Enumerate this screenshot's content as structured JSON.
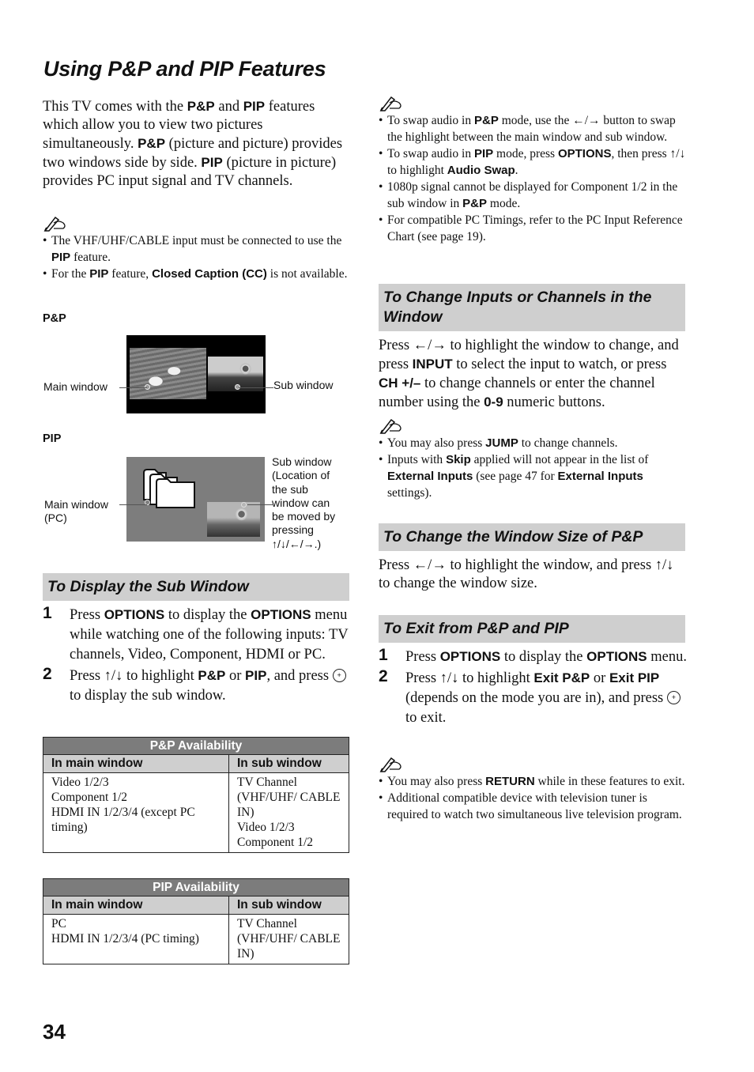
{
  "page": {
    "title": "Using P&P and PIP Features",
    "page_number": "34"
  },
  "intro": {
    "segments": [
      {
        "t": "This TV comes with the "
      },
      {
        "b": "P&P"
      },
      {
        "t": " and "
      },
      {
        "b": "PIP"
      },
      {
        "t": " features which allow you to view two pictures simultaneously. "
      },
      {
        "b": "P&P"
      },
      {
        "t": " (picture and picture) provides two windows side by side. "
      },
      {
        "b": "PIP"
      },
      {
        "t": " (picture in picture) provides PC input signal and TV channels."
      }
    ]
  },
  "notes_intro": {
    "icon": "memo-pencil-icon",
    "items": [
      [
        {
          "t": "The VHF/UHF/CABLE input must be connected to use the "
        },
        {
          "b": "PIP"
        },
        {
          "t": " feature."
        }
      ],
      [
        {
          "t": "For the "
        },
        {
          "b": "PIP"
        },
        {
          "t": " feature, "
        },
        {
          "b": "Closed Caption (CC)"
        },
        {
          "t": " is not available."
        }
      ]
    ]
  },
  "figure_pp": {
    "label": "P&P",
    "main_callout": "Main window",
    "sub_callout": "Sub window",
    "main_image": "ducks-swimming-photo",
    "sub_image": "sunflower-photo"
  },
  "figure_pip": {
    "label": "PIP",
    "main_callout": [
      "Main window",
      "(PC)"
    ],
    "sub_callout": [
      "Sub window",
      "(Location of",
      "the sub",
      "window can",
      "be moved by",
      "pressing",
      "↑/↓/←/→.)"
    ],
    "main_image": "pc-folders-screen",
    "sub_image": "sunflower-photo"
  },
  "section_display": {
    "heading": "To Display the Sub Window",
    "steps": [
      {
        "num": "1",
        "segments": [
          {
            "t": "Press "
          },
          {
            "b": "OPTIONS"
          },
          {
            "t": " to display the "
          },
          {
            "b": "OPTIONS"
          },
          {
            "t": " menu while watching one of the following inputs: TV channels, Video, Component, HDMI or PC."
          }
        ]
      },
      {
        "num": "2",
        "segments": [
          {
            "t": "Press ↑/↓ to highlight "
          },
          {
            "b": "P&P"
          },
          {
            "t": " or "
          },
          {
            "b": "PIP"
          },
          {
            "t": ", and press "
          },
          {
            "icon": "enter-button-icon"
          },
          {
            "t": "to display the sub window."
          }
        ]
      }
    ]
  },
  "tables": [
    {
      "title": "P&P Availability",
      "headers": [
        "In main window",
        "In sub window"
      ],
      "rows": [
        [
          [
            "Video 1/2/3",
            "Component 1/2",
            "HDMI IN 1/2/3/4 (except PC timing)"
          ],
          [
            "TV Channel (VHF/UHF/ CABLE IN)",
            "Video 1/2/3",
            "Component 1/2"
          ]
        ]
      ]
    },
    {
      "title": "PIP Availability",
      "headers": [
        "In main window",
        "In sub window"
      ],
      "rows": [
        [
          [
            "PC",
            "HDMI IN 1/2/3/4 (PC timing)"
          ],
          [
            "TV Channel (VHF/UHF/ CABLE IN)"
          ]
        ]
      ]
    }
  ],
  "notes_right_top": {
    "icon": "memo-pencil-icon",
    "items": [
      [
        {
          "t": "To swap audio in "
        },
        {
          "b": "P&P"
        },
        {
          "t": " mode, use the ←/→ button to swap the highlight between the main window and sub window."
        }
      ],
      [
        {
          "t": "To swap audio in "
        },
        {
          "b": "PIP"
        },
        {
          "t": " mode, press "
        },
        {
          "b": "OPTIONS"
        },
        {
          "t": ", then press ↑/↓ to highlight "
        },
        {
          "b": "Audio Swap"
        },
        {
          "t": "."
        }
      ],
      [
        {
          "t": "1080p signal cannot be displayed for Component 1/2 in the sub window in "
        },
        {
          "b": "P&P"
        },
        {
          "t": " mode."
        }
      ],
      [
        {
          "t": "For compatible PC Timings, refer to the PC Input Reference Chart (see page 19)."
        }
      ]
    ]
  },
  "section_change_inputs": {
    "heading": "To Change Inputs or Channels in the Window",
    "body": [
      {
        "t": "Press ←/→ to highlight the window to change, and press "
      },
      {
        "b": "INPUT"
      },
      {
        "t": " to select the input to watch, or press "
      },
      {
        "b": "CH +/–"
      },
      {
        "t": " to change channels or enter the channel number using the "
      },
      {
        "b": "0-9"
      },
      {
        "t": " numeric buttons."
      }
    ],
    "notes": [
      [
        {
          "t": "You may also press "
        },
        {
          "b": "JUMP"
        },
        {
          "t": " to change channels."
        }
      ],
      [
        {
          "t": "Inputs with "
        },
        {
          "b": "Skip"
        },
        {
          "t": " applied will not appear in the list of "
        },
        {
          "b": "External Inputs"
        },
        {
          "t": " (see page 47 for "
        },
        {
          "b": "External Inputs"
        },
        {
          "t": " settings)."
        }
      ]
    ]
  },
  "section_window_size": {
    "heading": "To Change the Window Size of P&P",
    "body": [
      {
        "t": "Press ←/→ to highlight the window, and press ↑/↓ to change the window size."
      }
    ]
  },
  "section_exit": {
    "heading": "To Exit from P&P and PIP",
    "steps": [
      {
        "num": "1",
        "segments": [
          {
            "t": "Press "
          },
          {
            "b": "OPTIONS"
          },
          {
            "t": " to display the "
          },
          {
            "b": "OPTIONS"
          },
          {
            "t": " menu."
          }
        ]
      },
      {
        "num": "2",
        "segments": [
          {
            "t": "Press ↑/↓ to highlight "
          },
          {
            "b": "Exit P&P"
          },
          {
            "t": " or "
          },
          {
            "b": "Exit PIP"
          },
          {
            "t": " (depends on the mode you are in), and press "
          },
          {
            "icon": "enter-button-icon"
          },
          {
            "t": "to exit."
          }
        ]
      }
    ],
    "notes": [
      [
        {
          "t": "You may also press "
        },
        {
          "b": "RETURN"
        },
        {
          "t": " while in these features to exit."
        }
      ],
      [
        {
          "t": "Additional compatible device with television tuner is required to watch two simultaneous live television program."
        }
      ]
    ]
  }
}
